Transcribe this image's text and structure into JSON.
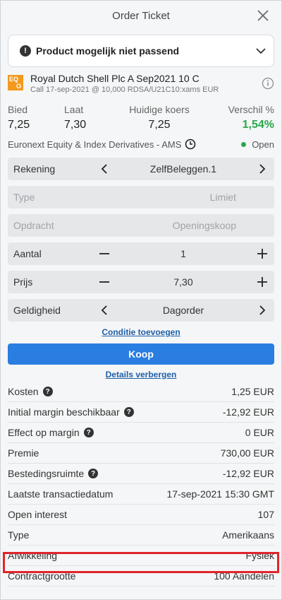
{
  "header": {
    "title": "Order Ticket"
  },
  "warning": {
    "text": "Product mogelijk niet passend"
  },
  "product": {
    "logo_top": "EQ",
    "logo_bottom": "O",
    "name": "Royal Dutch Shell Plc A Sep2021 10 C",
    "sub": "Call 17-sep-2021 @ 10,000 RDSA/U21C10:xams EUR"
  },
  "quotes": [
    {
      "label": "Bied",
      "value": "7,25"
    },
    {
      "label": "Laat",
      "value": "7,30"
    },
    {
      "label": "Huidige koers",
      "value": "7,25"
    },
    {
      "label": "Verschil %",
      "value": "1,54%"
    }
  ],
  "exchange": {
    "name": "Euronext Equity & Index Derivatives - AMS",
    "status": "Open"
  },
  "form": {
    "account": {
      "label": "Rekening",
      "value": "ZelfBeleggen.1"
    },
    "type": {
      "label": "Type",
      "value": "Limiet"
    },
    "order": {
      "label": "Opdracht",
      "value": "Openingskoop"
    },
    "quantity": {
      "label": "Aantal",
      "value": "1"
    },
    "price": {
      "label": "Prijs",
      "value": "7,30"
    },
    "validity": {
      "label": "Geldigheid",
      "value": "Dagorder"
    }
  },
  "links": {
    "add_condition": "Conditie toevoegen",
    "hide_details": "Details verbergen"
  },
  "buy_button": "Koop",
  "details": [
    {
      "label": "Kosten",
      "value": "1,25 EUR",
      "help": true
    },
    {
      "label": "Initial margin beschikbaar",
      "value": "-12,92 EUR",
      "help": true
    },
    {
      "label": "Effect op margin",
      "value": "0 EUR",
      "help": true
    },
    {
      "label": "Premie",
      "value": "730,00 EUR",
      "help": false
    },
    {
      "label": "Bestedingsruimte",
      "value": "-12,92 EUR",
      "help": true
    },
    {
      "label": "Laatste transactiedatum",
      "value": "17-sep-2021 15:30 GMT",
      "help": false
    },
    {
      "label": "Open interest",
      "value": "107",
      "help": false
    },
    {
      "label": "Type",
      "value": "Amerikaans",
      "help": false
    },
    {
      "label": "Afwikkeling",
      "value": "Fysiek",
      "help": false
    },
    {
      "label": "Contractgrootte",
      "value": "100 Aandelen",
      "help": false
    }
  ],
  "colors": {
    "accent": "#2a7de1",
    "positive": "#27a94b",
    "highlight": "#e0242b",
    "logo": "#f39a1e"
  },
  "icons": {
    "close": "close-icon",
    "warning": "exclamation-icon",
    "chevron": "chevron-down-icon",
    "info": "info-icon",
    "clock": "clock-icon",
    "help": "question-icon"
  }
}
